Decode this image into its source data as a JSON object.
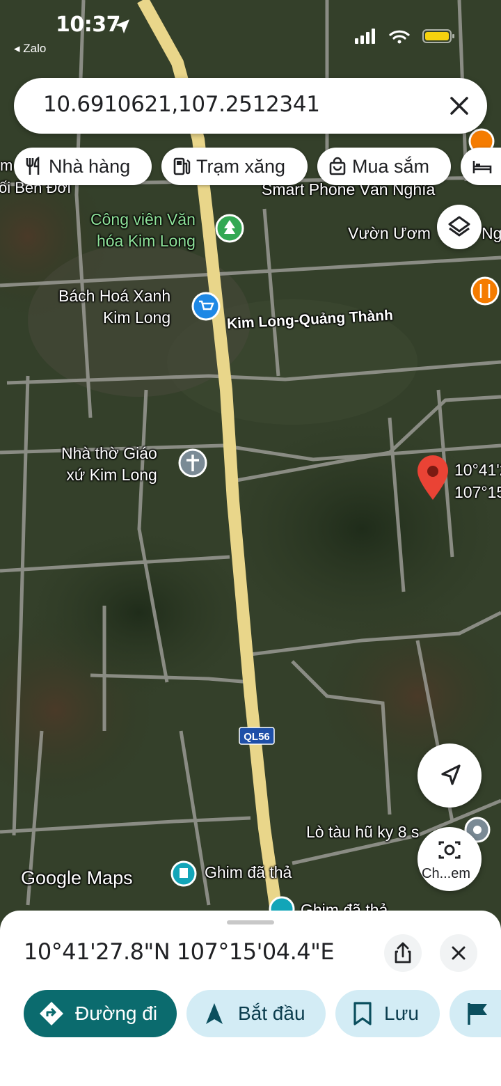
{
  "status_bar": {
    "time": "10:37",
    "back_app": "Zalo"
  },
  "search": {
    "query": "10.6910621,107.2512341"
  },
  "chips": [
    {
      "label": "Nhà hàng",
      "icon": "fork-knife-icon"
    },
    {
      "label": "Trạm xăng",
      "icon": "fuel-pump-icon"
    },
    {
      "label": "Mua sắm",
      "icon": "shopping-bag-icon"
    },
    {
      "label": "",
      "icon": "bed-icon"
    }
  ],
  "map_labels": {
    "ben_doi": "ối Bến Đới",
    "chip_edge_m": "m",
    "smart_phone": "Smart Phone Văn Nghĩa",
    "park": "Công viên Văn\nhóa Kim Long",
    "vuon_uom": "Vườn Ươm",
    "vuon_uom_tail": "Ng",
    "bach_hoa": "Bách Hoá Xanh\nKim Long",
    "road_kl_qt": "Kim Long-Quảng Thành",
    "church": "Nhà thờ Giáo\nxứ Kim Long",
    "pin_lat": "10°41'2",
    "pin_lng": "107°15",
    "highway": "QL56",
    "lo_tau_hu": "Lò tàu hũ ky 8 s",
    "ghim1": "Ghim đã thả",
    "ghim2": "Ghim đã thả",
    "logo": "Google Maps",
    "camera_label": "Ch...em"
  },
  "sheet": {
    "coords": "10°41'27.8\"N 107°15'04.4\"E",
    "directions_label": "Đường đi",
    "start_label": "Bắt đầu",
    "save_label": "Lưu"
  },
  "colors": {
    "primary": "#0b6b6e",
    "tonal": "#d3ecf5",
    "pin": "#ea4335"
  }
}
